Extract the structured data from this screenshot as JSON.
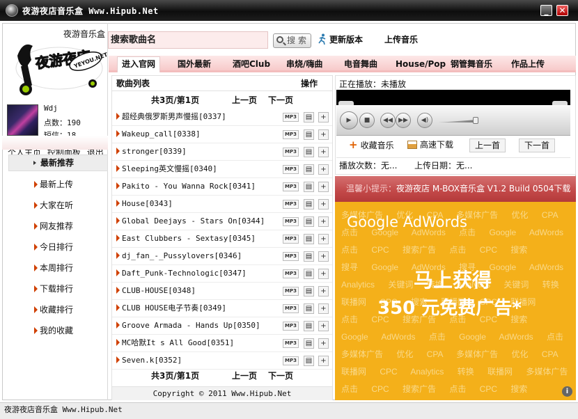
{
  "window": {
    "title": "夜游夜店音乐盒 Www.Hipub.Net",
    "minimize": "_",
    "close": "✕"
  },
  "brand": {
    "label": "夜游音乐盒",
    "logo_text": "夜游夜店",
    "logo_badge": "YEYOU.NET"
  },
  "user": {
    "name": "Wdj",
    "points": "点数：190",
    "messages": "短信：18",
    "links": [
      "个人主页",
      "控制面板",
      "退出"
    ]
  },
  "nav": {
    "active": "最新推荐",
    "items": [
      "最新上传",
      "大家在听",
      "网友推荐",
      "今日排行",
      "本周排行",
      "下载排行",
      "收藏排行",
      "我的收藏"
    ]
  },
  "search": {
    "placeholder": "搜索歌曲名",
    "button": "搜 索",
    "update": "更新版本",
    "upload": "上传音乐"
  },
  "tabs": [
    "进入官网",
    "国外最新",
    "酒吧Club",
    "串烧/嗨曲",
    "电音舞曲",
    "House/Pop",
    "钢管舞音乐",
    "作品上传"
  ],
  "song_list": {
    "title": "歌曲列表",
    "action_header": "操作",
    "page_info": "共3页/第1页",
    "prev": "上一页",
    "next": "下一页",
    "mp3_label": "MP3",
    "add_label": "+",
    "songs": [
      "超经典俄罗斯男声慢摇[0337]",
      "Wakeup_call[0338]",
      "stronger[0339]",
      "Sleeping英文慢摇[0340]",
      "Pakito - You Wanna Rock[0341]",
      "House[0343]",
      "Global Deejays - Stars On[0344]",
      "East Clubbers - Sextasy[0345]",
      "dj_fan_-_Pussylovers[0346]",
      "Daft_Punk-Technologic[0347]",
      "CLUB-HOUSE[0348]",
      "CLUB HOUSE电子节奏[0349]",
      "Groove Armada - Hands Up[0350]",
      "MC哈默It s All Good[0351]",
      "Seven.k[0352]"
    ],
    "copyright": "Copyright © 2011 Www.Hipub.Net"
  },
  "player": {
    "now_playing": "正在播放：未播放",
    "favorite": "收藏音乐",
    "download": "高速下载",
    "prev": "上一首",
    "next": "下一首",
    "play_count": "播放次数：无...",
    "upload_date": "上传日期：无..."
  },
  "tip": {
    "label": "温馨小提示：",
    "text": "夜游夜店 M-BOX音乐盒 V1.2 Build 0504下载"
  },
  "ad": {
    "title": "Google AdWords",
    "line1": "马上获得",
    "line2": "350 元免费广告*",
    "bg_words": [
      "多媒体广告 优化 CPA 多媒体广告 优化 CPA",
      "点击 Google AdWords 点击 Google AdWords 关键词",
      "点击 CPC 搜索广告 点击 CPC 搜索",
      "搜寻 Google AdWords 搜寻 Google AdWords",
      "Analytics 关键词 转换 Analytics 关键词 转换",
      "联播网 CPC 搜索 联播网 CPC 联播网",
      "点击 CPC 搜索广告 点击 CPC 搜索",
      "Google AdWords 点击 Google AdWords 点击",
      "多媒体广告 优化 CPA 多媒体广告 优化 CPA",
      "联播网 CPC Analytics 转换 联播网 多媒体广告",
      "点击 CPC 搜索广告 点击 CPC 搜索"
    ],
    "info_icon": "i"
  },
  "status": {
    "text": "夜游夜店音乐盒 Www.Hipub.Net"
  },
  "colors": {
    "titlebar": "#1a1a1a",
    "tab_bar": "#f7caca",
    "tip_bar": "#c24848",
    "ad_bg": "#f4b01a",
    "accent_triangle": "#d04000"
  }
}
